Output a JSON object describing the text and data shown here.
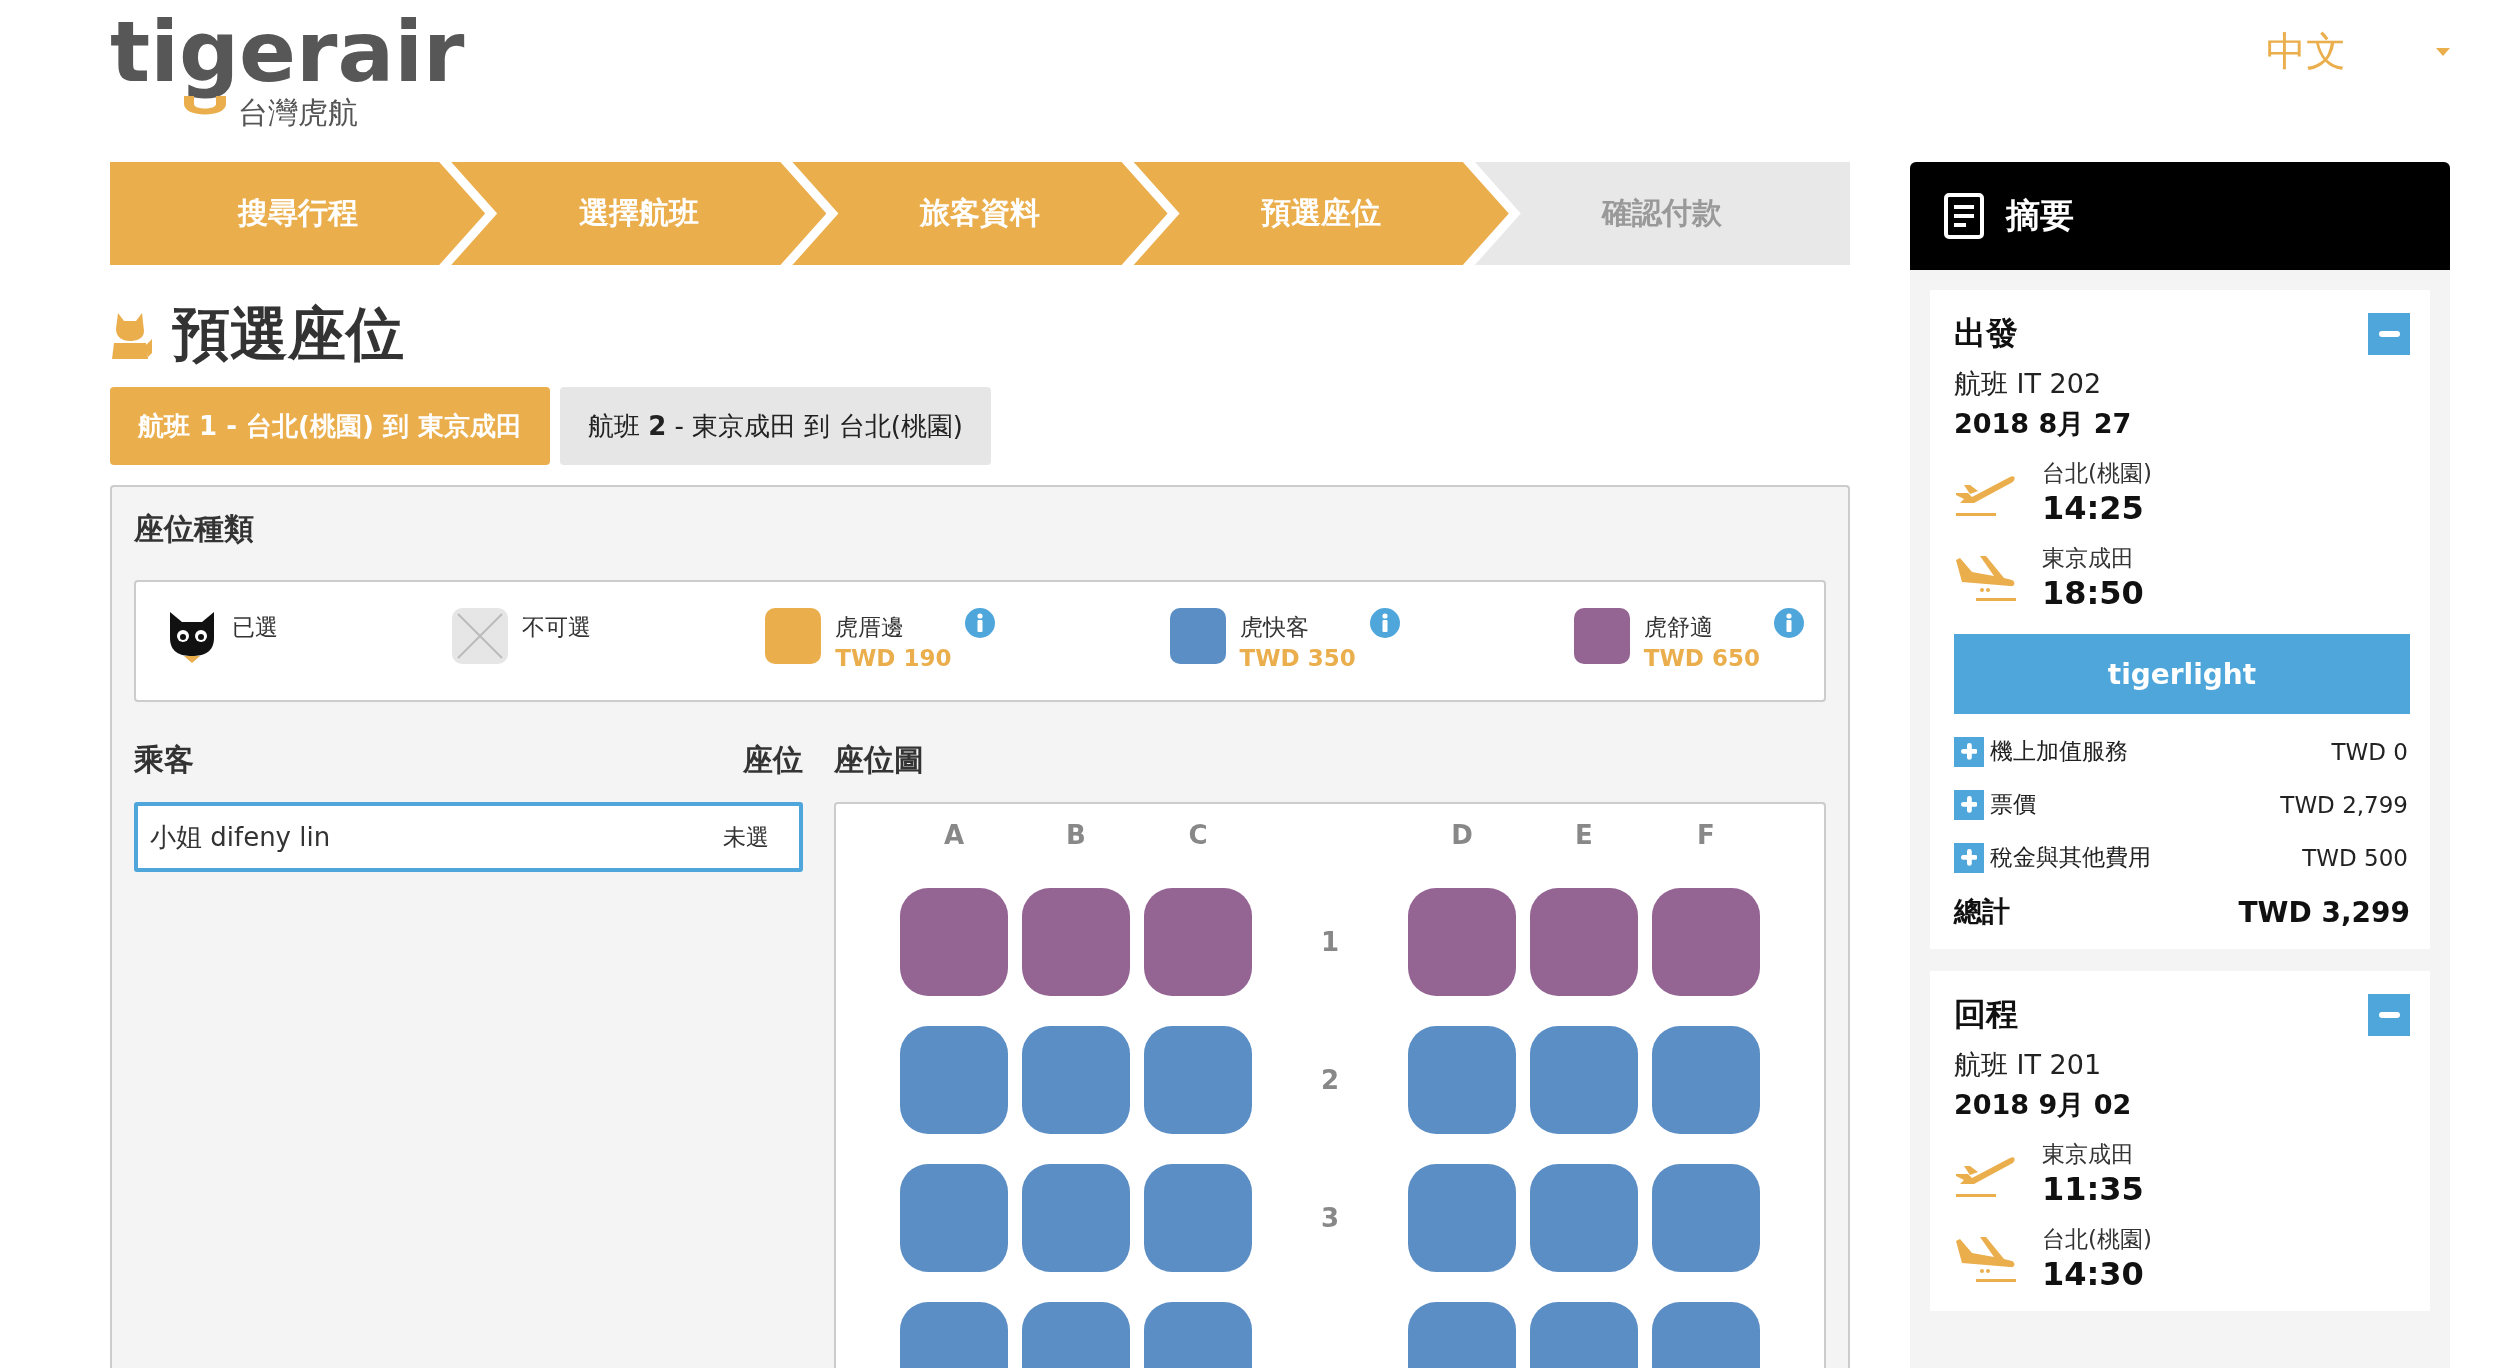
{
  "logo": {
    "brand": "tigerair",
    "subtitle": "台灣虎航"
  },
  "language": {
    "label": "中文"
  },
  "steps": [
    {
      "label": "搜尋行程",
      "completed": true
    },
    {
      "label": "選擇航班",
      "completed": true
    },
    {
      "label": "旅客資料",
      "completed": true
    },
    {
      "label": "預選座位",
      "completed": true
    },
    {
      "label": "確認付款",
      "completed": false
    }
  ],
  "page_title": "預選座位",
  "flight_tabs": [
    {
      "label": "航班 **1** - 台北(桃園) 到 東京成田",
      "selected": true
    },
    {
      "label": "航班 **2** - 東京成田 到 台北(桃園)",
      "selected": false
    }
  ],
  "seat_types": {
    "title": "座位種類",
    "items": [
      {
        "kind": "selected",
        "name": "已選"
      },
      {
        "kind": "unavailable",
        "name": "不可選"
      },
      {
        "kind": "seat",
        "name": "虎厝邊",
        "price": "TWD 190",
        "color": "#ebae4c"
      },
      {
        "kind": "seat",
        "name": "虎快客",
        "price": "TWD 350",
        "color": "#5b8ec4"
      },
      {
        "kind": "seat",
        "name": "虎舒適",
        "price": "TWD 650",
        "color": "#946593"
      }
    ]
  },
  "passengers": {
    "heading": "乘客",
    "seat_heading": "座位",
    "items": [
      {
        "name": "小姐 difeny lin",
        "seat": "未選",
        "selected": true
      }
    ]
  },
  "seat_map": {
    "title": "座位圖",
    "columns": [
      "A",
      "B",
      "C",
      "D",
      "E",
      "F"
    ],
    "rows": [
      {
        "label": "1",
        "seats": [
          {
            "color": "#946593"
          },
          {
            "color": "#946593"
          },
          {
            "color": "#946593"
          },
          {
            "color": "#946593"
          },
          {
            "color": "#946593"
          },
          {
            "color": "#946593"
          }
        ]
      },
      {
        "label": "2",
        "seats": [
          {
            "color": "#5b8ec4"
          },
          {
            "color": "#5b8ec4"
          },
          {
            "color": "#5b8ec4"
          },
          {
            "color": "#5b8ec4"
          },
          {
            "color": "#5b8ec4"
          },
          {
            "color": "#5b8ec4"
          }
        ]
      },
      {
        "label": "3",
        "seats": [
          {
            "color": "#5b8ec4"
          },
          {
            "color": "#5b8ec4"
          },
          {
            "color": "#5b8ec4"
          },
          {
            "color": "#5b8ec4"
          },
          {
            "color": "#5b8ec4"
          },
          {
            "color": "#5b8ec4"
          }
        ]
      },
      {
        "seats": [
          {
            "color": "#5b8ec4"
          },
          {
            "color": "#5b8ec4"
          },
          {
            "color": "#5b8ec4"
          },
          {
            "color": "#5b8ec4"
          },
          {
            "color": "#5b8ec4"
          },
          {
            "color": "#5b8ec4"
          }
        ]
      }
    ]
  },
  "summary": {
    "title": "摘要",
    "trips": [
      {
        "title": "出發",
        "expanded": true,
        "flight": "航班 IT 202",
        "date": "2018 8月 27",
        "legs": [
          {
            "kind": "departure",
            "city": "台北(桃園)",
            "time": "14:25"
          },
          {
            "kind": "arrival",
            "city": "東京成田",
            "time": "18:50"
          }
        ],
        "fare": "tigerlight",
        "fees": [
          {
            "label": "機上加值服務",
            "amount": "TWD 0",
            "expanded": false
          },
          {
            "label": "票價",
            "amount": "TWD 2,799",
            "expanded": false
          },
          {
            "label": "稅金與其他費用",
            "amount": "TWD 500",
            "expanded": false
          }
        ],
        "total_label": "總計",
        "total": "TWD 3,299"
      },
      {
        "title": "回程",
        "expanded": true,
        "flight": "航班 IT 201",
        "date": "2018 9月 02",
        "legs": [
          {
            "kind": "departure",
            "city": "東京成田",
            "time": "11:35"
          },
          {
            "kind": "arrival",
            "city": "台北(桃園)",
            "time": "14:30"
          }
        ]
      }
    ]
  }
}
